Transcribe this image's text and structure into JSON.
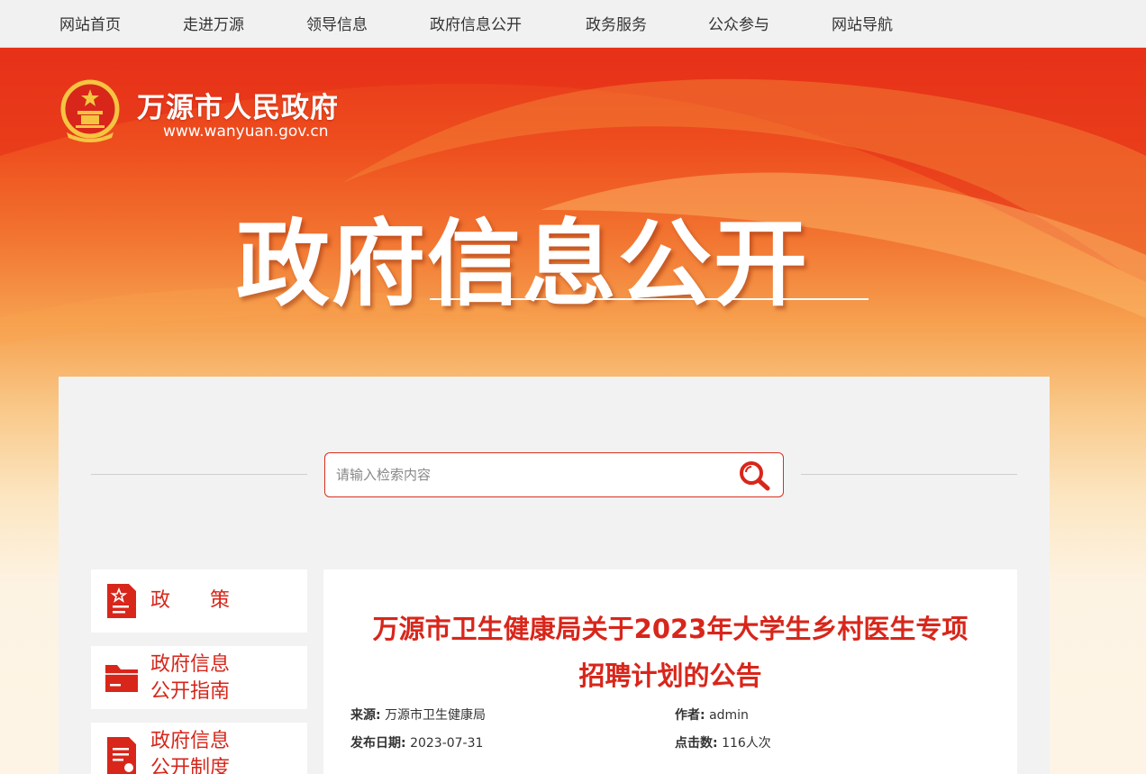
{
  "nav": {
    "items": [
      "网站首页",
      "走进万源",
      "领导信息",
      "政府信息公开",
      "政务服务",
      "公众参与",
      "网站导航"
    ]
  },
  "header": {
    "site_name": "万源市人民政府",
    "site_url": "www.wanyuan.gov.cn",
    "emblem_icon": "national-emblem-icon"
  },
  "hero": {
    "title": "政府信息公开"
  },
  "search": {
    "placeholder": "请输入检索内容",
    "value": "",
    "icon": "search-icon"
  },
  "sidebar": {
    "items": [
      {
        "label": "政　　策",
        "icon": "policy-document-icon"
      },
      {
        "label_line1": "政府信息",
        "label_line2": "公开指南",
        "icon": "folder-icon"
      },
      {
        "label_line1": "政府信息",
        "label_line2": "公开制度",
        "icon": "regulation-document-icon"
      }
    ]
  },
  "article": {
    "title_line1": "万源市卫生健康局关于2023年大学生乡村医生专项",
    "title_line2": "招聘计划的公告",
    "source_label": "来源:",
    "source_value": "万源市卫生健康局",
    "author_label": "作者:",
    "author_value": "admin",
    "date_label": "发布日期:",
    "date_value": "2023-07-31",
    "clicks_label": "点击数:",
    "clicks_value": "116人次"
  },
  "colors": {
    "accent_red": "#d8261b",
    "nav_bg": "#f1f1f1",
    "panel_bg": "#f2f2f2"
  }
}
